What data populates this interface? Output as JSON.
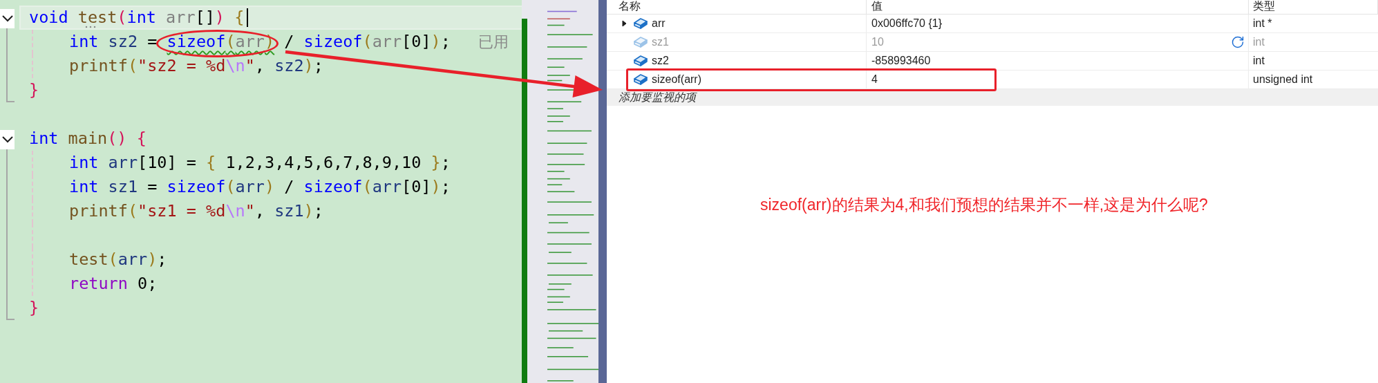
{
  "editor": {
    "blocks": [
      {
        "kind": "function",
        "current": true,
        "fold": true,
        "tokens": [
          {
            "kind": "kw",
            "text": "void "
          },
          {
            "kind": "fn",
            "text": "test",
            "dotted": true
          },
          {
            "kind": "p1",
            "text": "("
          },
          {
            "kind": "kw",
            "text": "int "
          },
          {
            "kind": "param",
            "text": "arr"
          },
          {
            "kind": "op",
            "text": "[]"
          },
          {
            "kind": "p1",
            "text": ") "
          },
          {
            "kind": "p2",
            "text": "{"
          }
        ],
        "children": [
          {
            "kind": "code",
            "hint": "已用",
            "tokens": [
              {
                "kind": "kw",
                "text": "int "
              },
              {
                "kind": "var",
                "text": "sz2 "
              },
              {
                "kind": "op",
                "text": "= "
              },
              {
                "kind": "group",
                "circled": true,
                "squiggle": true,
                "tokens": [
                  {
                    "kind": "kw",
                    "text": "sizeof"
                  },
                  {
                    "kind": "p2",
                    "text": "("
                  },
                  {
                    "kind": "param",
                    "text": "arr"
                  },
                  {
                    "kind": "p2",
                    "text": ")"
                  }
                ]
              },
              {
                "kind": "op",
                "text": " / "
              },
              {
                "kind": "kw",
                "text": "sizeof"
              },
              {
                "kind": "p2",
                "text": "("
              },
              {
                "kind": "param",
                "text": "arr"
              },
              {
                "kind": "op",
                "text": "[0]"
              },
              {
                "kind": "p2",
                "text": ")"
              },
              {
                "kind": "op",
                "text": ";"
              }
            ]
          },
          {
            "kind": "code",
            "tokens": [
              {
                "kind": "fn",
                "text": "printf"
              },
              {
                "kind": "p2",
                "text": "("
              },
              {
                "kind": "str",
                "text": "\"sz2 = %d"
              },
              {
                "kind": "esc",
                "text": "\\n"
              },
              {
                "kind": "str",
                "text": "\""
              },
              {
                "kind": "op",
                "text": ", "
              },
              {
                "kind": "var",
                "text": "sz2"
              },
              {
                "kind": "p2",
                "text": ")"
              },
              {
                "kind": "op",
                "text": ";"
              }
            ]
          }
        ],
        "closing": [
          {
            "kind": "p1",
            "text": "}"
          }
        ]
      },
      {
        "kind": "blank"
      },
      {
        "kind": "function",
        "current": false,
        "fold": true,
        "tokens": [
          {
            "kind": "kw",
            "text": "int "
          },
          {
            "kind": "fn",
            "text": "main"
          },
          {
            "kind": "p1",
            "text": "() "
          },
          {
            "kind": "p1",
            "text": "{"
          }
        ],
        "children": [
          {
            "kind": "code",
            "tokens": [
              {
                "kind": "kw",
                "text": "int "
              },
              {
                "kind": "var",
                "text": "arr"
              },
              {
                "kind": "op",
                "text": "[10] = "
              },
              {
                "kind": "p2",
                "text": "{"
              },
              {
                "kind": "num",
                "text": " 1,2,3,4,5,6,7,8,9,10 "
              },
              {
                "kind": "p2",
                "text": "}"
              },
              {
                "kind": "op",
                "text": ";"
              }
            ]
          },
          {
            "kind": "code",
            "tokens": [
              {
                "kind": "kw",
                "text": "int "
              },
              {
                "kind": "var",
                "text": "sz1 "
              },
              {
                "kind": "op",
                "text": "= "
              },
              {
                "kind": "kw",
                "text": "sizeof"
              },
              {
                "kind": "p2",
                "text": "("
              },
              {
                "kind": "var",
                "text": "arr"
              },
              {
                "kind": "p2",
                "text": ")"
              },
              {
                "kind": "op",
                "text": " / "
              },
              {
                "kind": "kw",
                "text": "sizeof"
              },
              {
                "kind": "p2",
                "text": "("
              },
              {
                "kind": "var",
                "text": "arr"
              },
              {
                "kind": "op",
                "text": "[0]"
              },
              {
                "kind": "p2",
                "text": ")"
              },
              {
                "kind": "op",
                "text": ";"
              }
            ]
          },
          {
            "kind": "code",
            "tokens": [
              {
                "kind": "fn",
                "text": "printf"
              },
              {
                "kind": "p2",
                "text": "("
              },
              {
                "kind": "str",
                "text": "\"sz1 = %d"
              },
              {
                "kind": "esc",
                "text": "\\n"
              },
              {
                "kind": "str",
                "text": "\""
              },
              {
                "kind": "op",
                "text": ", "
              },
              {
                "kind": "var",
                "text": "sz1"
              },
              {
                "kind": "p2",
                "text": ")"
              },
              {
                "kind": "op",
                "text": ";"
              }
            ]
          },
          {
            "kind": "blank"
          },
          {
            "kind": "code",
            "tokens": [
              {
                "kind": "fn",
                "text": "test"
              },
              {
                "kind": "p2",
                "text": "("
              },
              {
                "kind": "var",
                "text": "arr"
              },
              {
                "kind": "p2",
                "text": ")"
              },
              {
                "kind": "op",
                "text": ";"
              }
            ]
          },
          {
            "kind": "code",
            "tokens": [
              {
                "kind": "ctl",
                "text": "return "
              },
              {
                "kind": "num",
                "text": "0"
              },
              {
                "kind": "op",
                "text": ";"
              }
            ]
          }
        ],
        "closing": [
          {
            "kind": "p1",
            "text": "}"
          }
        ]
      }
    ]
  },
  "watch": {
    "columns": [
      "名称",
      "值",
      "类型"
    ],
    "rows": [
      {
        "name": "arr",
        "value": "0x006ffc70 {1}",
        "type": "int *",
        "expandable": true,
        "stale": false,
        "highlighted": false
      },
      {
        "name": "sz1",
        "value": "10",
        "type": "int",
        "expandable": false,
        "stale": true,
        "highlighted": false
      },
      {
        "name": "sz2",
        "value": "-858993460",
        "type": "int",
        "expandable": false,
        "stale": false,
        "highlighted": false
      },
      {
        "name": "sizeof(arr)",
        "value": "4",
        "type": "unsigned int",
        "expandable": false,
        "stale": false,
        "highlighted": true
      }
    ],
    "add_placeholder": "添加要监视的项"
  },
  "annotation": {
    "text": "sizeof(arr)的结果为4,和我们预想的结果并不一样,这是为什么呢?"
  }
}
